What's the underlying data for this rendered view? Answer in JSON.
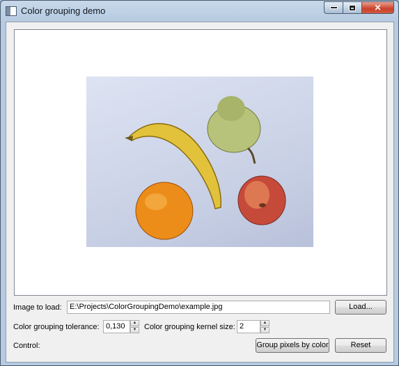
{
  "window": {
    "title": "Color grouping demo"
  },
  "image_panel": {},
  "controls": {
    "image_label": "Image to load:",
    "image_path": "E:\\Projects\\ColorGroupingDemo\\example.jpg",
    "load_button": "Load...",
    "tolerance_label": "Color grouping tolerance:",
    "tolerance_value": "0,130",
    "kernel_label": "Color grouping kernel size:",
    "kernel_value": "2",
    "control_label": "Control:",
    "group_button": "Group pixels by color",
    "reset_button": "Reset"
  },
  "icons": {
    "minimize": "minimize-icon",
    "maximize": "maximize-icon",
    "close": "close-icon"
  }
}
